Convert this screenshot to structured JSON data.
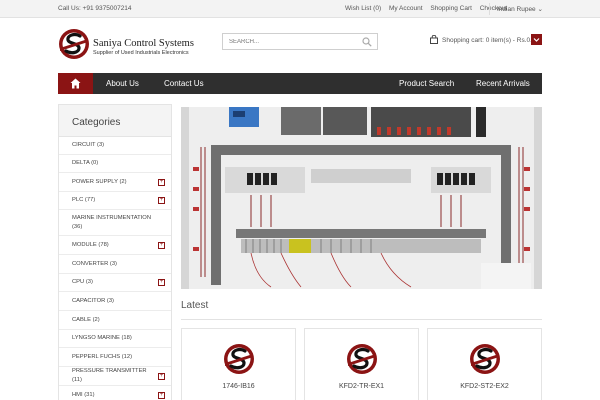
{
  "topbar": {
    "phone": "Call Us: +91 9375007214",
    "links": [
      "Wish List (0)",
      "My Account",
      "Shopping Cart",
      "Checkout"
    ],
    "currency": "Indian Rupee"
  },
  "logo": {
    "name": "Saniya Control Systems",
    "tagline": "Supplier of Used Industrials Electronics"
  },
  "search": {
    "placeholder": "SEARCH..."
  },
  "cart": {
    "text": "Shopping cart: 0 item(s) - Rs.0.00"
  },
  "nav": {
    "items": [
      "About Us",
      "Contact Us",
      "Product Search",
      "Recent Arrivals"
    ]
  },
  "sidebar": {
    "title": "Categories",
    "items": [
      {
        "label": "CIRCUIT (3)",
        "expandable": false
      },
      {
        "label": "DELTA (0)",
        "expandable": false
      },
      {
        "label": "POWER SUPPLY (2)",
        "expandable": true
      },
      {
        "label": "PLC (77)",
        "expandable": true
      },
      {
        "label": "MARINE INSTRUMENTATION (36)",
        "expandable": false
      },
      {
        "label": "MODULE (78)",
        "expandable": true
      },
      {
        "label": "CONVERTER (3)",
        "expandable": false
      },
      {
        "label": "CPU (3)",
        "expandable": true
      },
      {
        "label": "CAPACITOR (3)",
        "expandable": false
      },
      {
        "label": "CABLE (2)",
        "expandable": false
      },
      {
        "label": "LYNGSO MARINE (18)",
        "expandable": false
      },
      {
        "label": "PEPPERL FUCHS (12)",
        "expandable": false
      },
      {
        "label": "PRESSURE TRANSMITTER (11)",
        "expandable": true
      },
      {
        "label": "HMI (31)",
        "expandable": true
      }
    ]
  },
  "latest": {
    "title": "Latest",
    "products": [
      "1746-IB16",
      "KFD2-TR-EX1",
      "KFD2-ST2-EX2"
    ]
  },
  "colors": {
    "brand": "#8b1414",
    "nav": "#2f2f2f"
  }
}
